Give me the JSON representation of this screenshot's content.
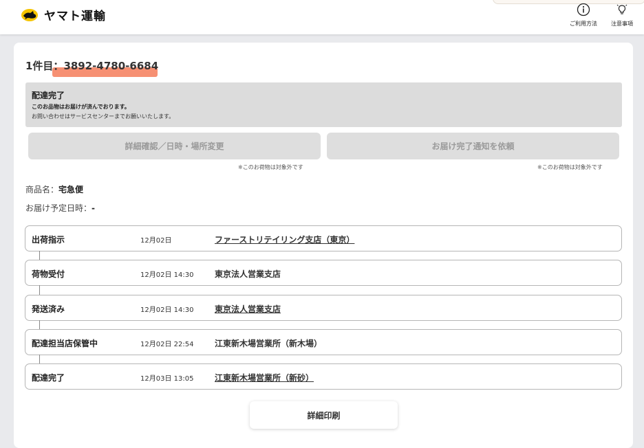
{
  "header": {
    "logo_text": "ヤマト運輸",
    "usage_label": "ご利用方法",
    "notes_label": "注意事項"
  },
  "shipment": {
    "index_label": "1件目：",
    "tracking_number": "3892-4780-6684",
    "status_title": "配達完了",
    "status_message": "このお品物はお届けが済んでおります。",
    "status_contact": "お問い合わせはサービスセンターまでお願いいたします。"
  },
  "actions": {
    "detail_change_label": "詳細確認／日時・場所変更",
    "notify_label": "お届け完了通知を依頼",
    "not_applicable_note": "※このお荷物は対象外です"
  },
  "product": {
    "name_label": "商品名：",
    "name_value": "宅急便",
    "eta_label": "お届け予定日時：",
    "eta_value": "-"
  },
  "timeline": [
    {
      "status": "出荷指示",
      "datetime": "12月02日",
      "location": "ファーストリテイリング支店（東京）",
      "linked": true
    },
    {
      "status": "荷物受付",
      "datetime": "12月02日 14:30",
      "location": "東京法人営業支店",
      "linked": false
    },
    {
      "status": "発送済み",
      "datetime": "12月02日 14:30",
      "location": "東京法人営業支店",
      "linked": true
    },
    {
      "status": "配達担当店保管中",
      "datetime": "12月02日 22:54",
      "location": "江東新木場営業所（新木場）",
      "linked": false
    },
    {
      "status": "配達完了",
      "datetime": "12月03日 13:05",
      "location": "江東新木場営業所（新砂）",
      "linked": true
    }
  ],
  "print": {
    "label": "詳細印刷"
  },
  "colors": {
    "logo_yellow": "#f5c400",
    "highlight": "#f47c5b",
    "status_box_bg": "#dcdcdc",
    "disabled_button_bg": "#dedede"
  },
  "icons": {
    "usage": "info-circle-icon",
    "notes": "lightbulb-icon",
    "logo": "black-cat-logo"
  }
}
